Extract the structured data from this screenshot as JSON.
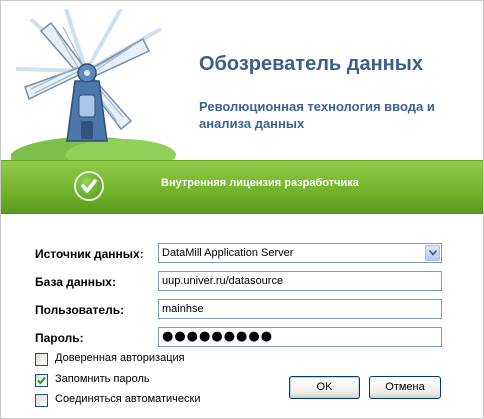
{
  "header": {
    "title": "Обозреватель данных",
    "subtitle": "Революционная технология ввода и анализа данных"
  },
  "license": {
    "text": "Внутренняя лицензия разработчика"
  },
  "form": {
    "datasource": {
      "label": "Источник данных:",
      "value": "DataMill Application Server"
    },
    "database": {
      "label": "База данных:",
      "value": "uup.univer.ru/datasource"
    },
    "user": {
      "label": "Пользователь:",
      "value": "mainhse"
    },
    "password": {
      "label": "Пароль:",
      "value": "●●●●●●●●●"
    }
  },
  "options": [
    {
      "label": "Доверенная авторизация",
      "checked": false
    },
    {
      "label": "Запомнить пароль",
      "checked": true
    },
    {
      "label": "Соединяться автоматически",
      "checked": false
    }
  ],
  "buttons": {
    "ok": "OK",
    "cancel": "Отмена"
  },
  "icons": {
    "logo": "windmill-logo-icon",
    "check": "checkmark-icon",
    "dropdown": "chevron-down-icon",
    "close": "close-icon"
  },
  "colors": {
    "accent_green": "#74b52d",
    "title_blue": "#3d5d8a"
  }
}
